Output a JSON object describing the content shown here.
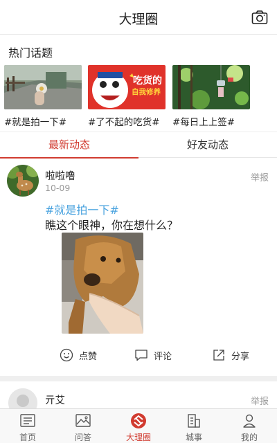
{
  "header": {
    "title": "大理圈",
    "camera_icon": "camera-icon"
  },
  "hot_topics": {
    "title": "热门话题",
    "items": [
      {
        "label": "#就是拍一下#",
        "image": "street-flower-photo"
      },
      {
        "label": "#了不起的吃货#",
        "image": "foodie-poster",
        "poster_text": "吃货的",
        "poster_sub": "自我修养"
      },
      {
        "label": "#每日上上签#",
        "image": "wind-chime-photo"
      }
    ]
  },
  "feed_tabs": [
    {
      "label": "最新动态",
      "active": true
    },
    {
      "label": "好友动态",
      "active": false
    }
  ],
  "post": {
    "username": "啦啦噜",
    "date": "10-09",
    "report": "举报",
    "hashtag": "#就是拍一下#",
    "text": "瞧这个眼神，你在想什么？",
    "image": "dog-photo",
    "actions": [
      {
        "label": "点赞",
        "icon": "smiley-like-icon"
      },
      {
        "label": "评论",
        "icon": "comment-icon"
      },
      {
        "label": "分享",
        "icon": "share-icon"
      }
    ]
  },
  "post2": {
    "username": "亓艾",
    "report": "举报"
  },
  "bottom_nav": [
    {
      "label": "首页",
      "icon": "home-list-icon",
      "active": false
    },
    {
      "label": "问答",
      "icon": "qa-image-icon",
      "active": false
    },
    {
      "label": "大理圈",
      "icon": "dali-circle-icon",
      "active": true
    },
    {
      "label": "城事",
      "icon": "city-building-icon",
      "active": false
    },
    {
      "label": "我的",
      "icon": "user-icon",
      "active": false
    }
  ],
  "colors": {
    "accent": "#d13b30",
    "hashtag": "#4aa3df",
    "muted": "#999999"
  }
}
